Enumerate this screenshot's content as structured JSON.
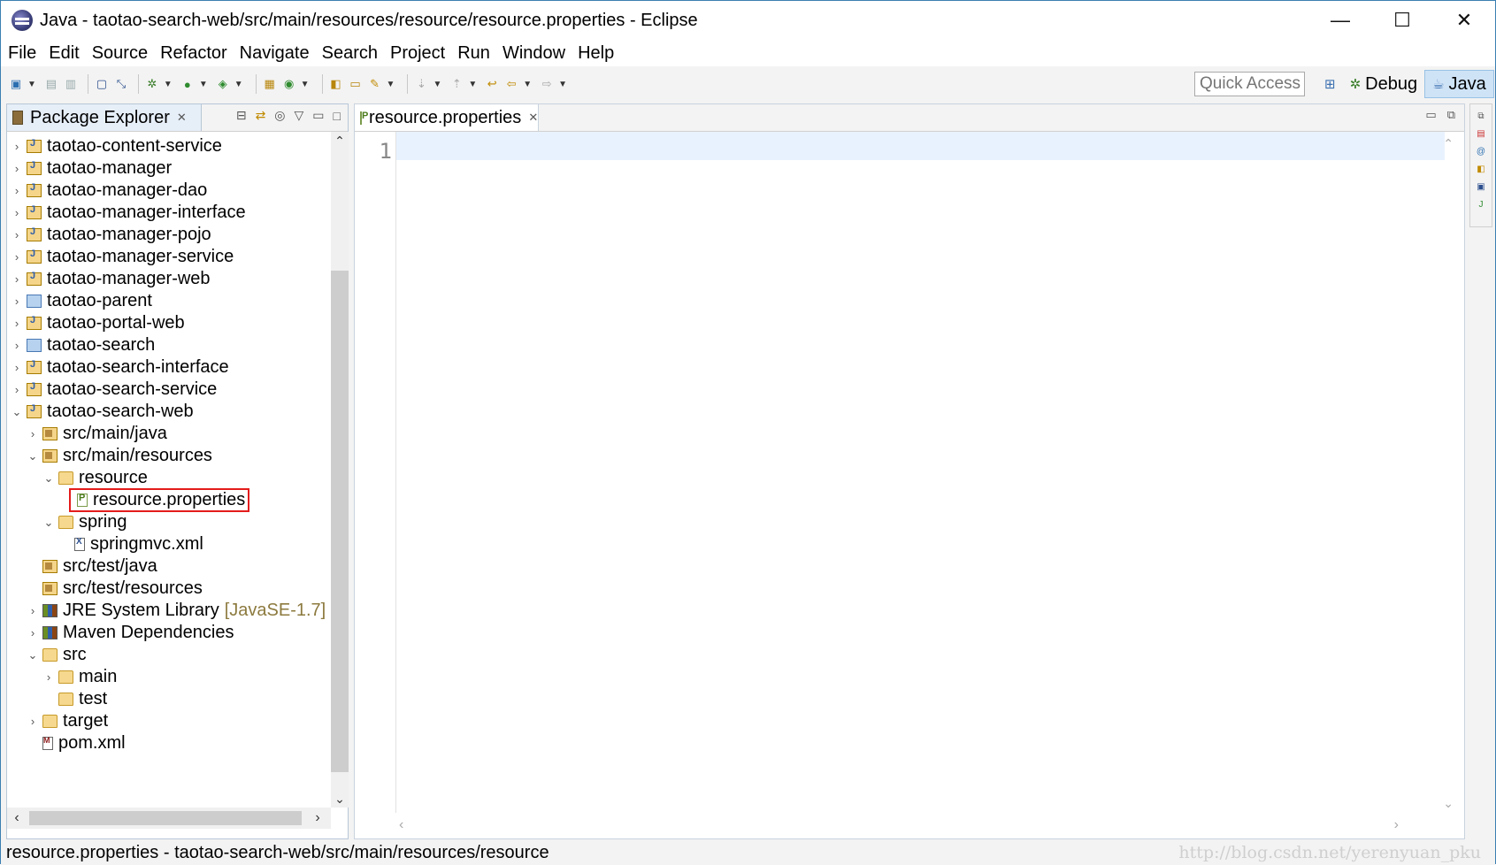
{
  "window": {
    "title": "Java - taotao-search-web/src/main/resources/resource/resource.properties - Eclipse",
    "controls": {
      "minimize": "—",
      "maximize": "☐",
      "close": "✕"
    }
  },
  "menubar": [
    "File",
    "Edit",
    "Source",
    "Refactor",
    "Navigate",
    "Search",
    "Project",
    "Run",
    "Window",
    "Help"
  ],
  "toolbar": {
    "quick_access_placeholder": "Quick Access",
    "perspectives": [
      {
        "label": "Debug",
        "active": false
      },
      {
        "label": "Java",
        "active": true
      }
    ]
  },
  "package_explorer": {
    "tab_label": "Package Explorer",
    "items": [
      {
        "label": "taotao-content-service",
        "depth": 0,
        "twisty": ">",
        "icon": "project-icon"
      },
      {
        "label": "taotao-manager",
        "depth": 0,
        "twisty": ">",
        "icon": "project-icon"
      },
      {
        "label": "taotao-manager-dao",
        "depth": 0,
        "twisty": ">",
        "icon": "project-icon"
      },
      {
        "label": "taotao-manager-interface",
        "depth": 0,
        "twisty": ">",
        "icon": "project-icon"
      },
      {
        "label": "taotao-manager-pojo",
        "depth": 0,
        "twisty": ">",
        "icon": "project-icon"
      },
      {
        "label": "taotao-manager-service",
        "depth": 0,
        "twisty": ">",
        "icon": "project-icon"
      },
      {
        "label": "taotao-manager-web",
        "depth": 0,
        "twisty": ">",
        "icon": "project-icon"
      },
      {
        "label": "taotao-parent",
        "depth": 0,
        "twisty": ">",
        "icon": "parent-project-icon"
      },
      {
        "label": "taotao-portal-web",
        "depth": 0,
        "twisty": ">",
        "icon": "project-icon"
      },
      {
        "label": "taotao-search",
        "depth": 0,
        "twisty": ">",
        "icon": "parent-project-icon"
      },
      {
        "label": "taotao-search-interface",
        "depth": 0,
        "twisty": ">",
        "icon": "project-icon"
      },
      {
        "label": "taotao-search-service",
        "depth": 0,
        "twisty": ">",
        "icon": "project-icon"
      },
      {
        "label": "taotao-search-web",
        "depth": 0,
        "twisty": "v",
        "icon": "project-icon"
      },
      {
        "label": "src/main/java",
        "depth": 1,
        "twisty": ">",
        "icon": "source-folder-icon"
      },
      {
        "label": "src/main/resources",
        "depth": 1,
        "twisty": "v",
        "icon": "source-folder-icon"
      },
      {
        "label": "resource",
        "depth": 2,
        "twisty": "v",
        "icon": "folder-icon"
      },
      {
        "label": "resource.properties",
        "depth": 3,
        "twisty": "",
        "icon": "properties-file-icon",
        "highlighted": true
      },
      {
        "label": "spring",
        "depth": 2,
        "twisty": "v",
        "icon": "folder-icon"
      },
      {
        "label": "springmvc.xml",
        "depth": 3,
        "twisty": "",
        "icon": "xml-file-icon"
      },
      {
        "label": "src/test/java",
        "depth": 1,
        "twisty": "",
        "icon": "source-folder-icon"
      },
      {
        "label": "src/test/resources",
        "depth": 1,
        "twisty": "",
        "icon": "source-folder-icon"
      },
      {
        "label": "JRE System Library",
        "decoration": "[JavaSE-1.7]",
        "depth": 1,
        "twisty": ">",
        "icon": "library-icon"
      },
      {
        "label": "Maven Dependencies",
        "depth": 1,
        "twisty": ">",
        "icon": "library-icon"
      },
      {
        "label": "src",
        "depth": 1,
        "twisty": "v",
        "icon": "folder-icon"
      },
      {
        "label": "main",
        "depth": 2,
        "twisty": ">",
        "icon": "folder-icon"
      },
      {
        "label": "test",
        "depth": 2,
        "twisty": "",
        "icon": "folder-icon"
      },
      {
        "label": "target",
        "depth": 1,
        "twisty": ">",
        "icon": "folder-icon"
      },
      {
        "label": "pom.xml",
        "depth": 1,
        "twisty": "",
        "icon": "pom-file-icon"
      }
    ]
  },
  "editor": {
    "tab_label": "resource.properties",
    "line_numbers": [
      "1"
    ]
  },
  "status_bar": {
    "text": "resource.properties - taotao-search-web/src/main/resources/resource"
  },
  "watermark": "http://blog.csdn.net/yerenyuan_pku"
}
